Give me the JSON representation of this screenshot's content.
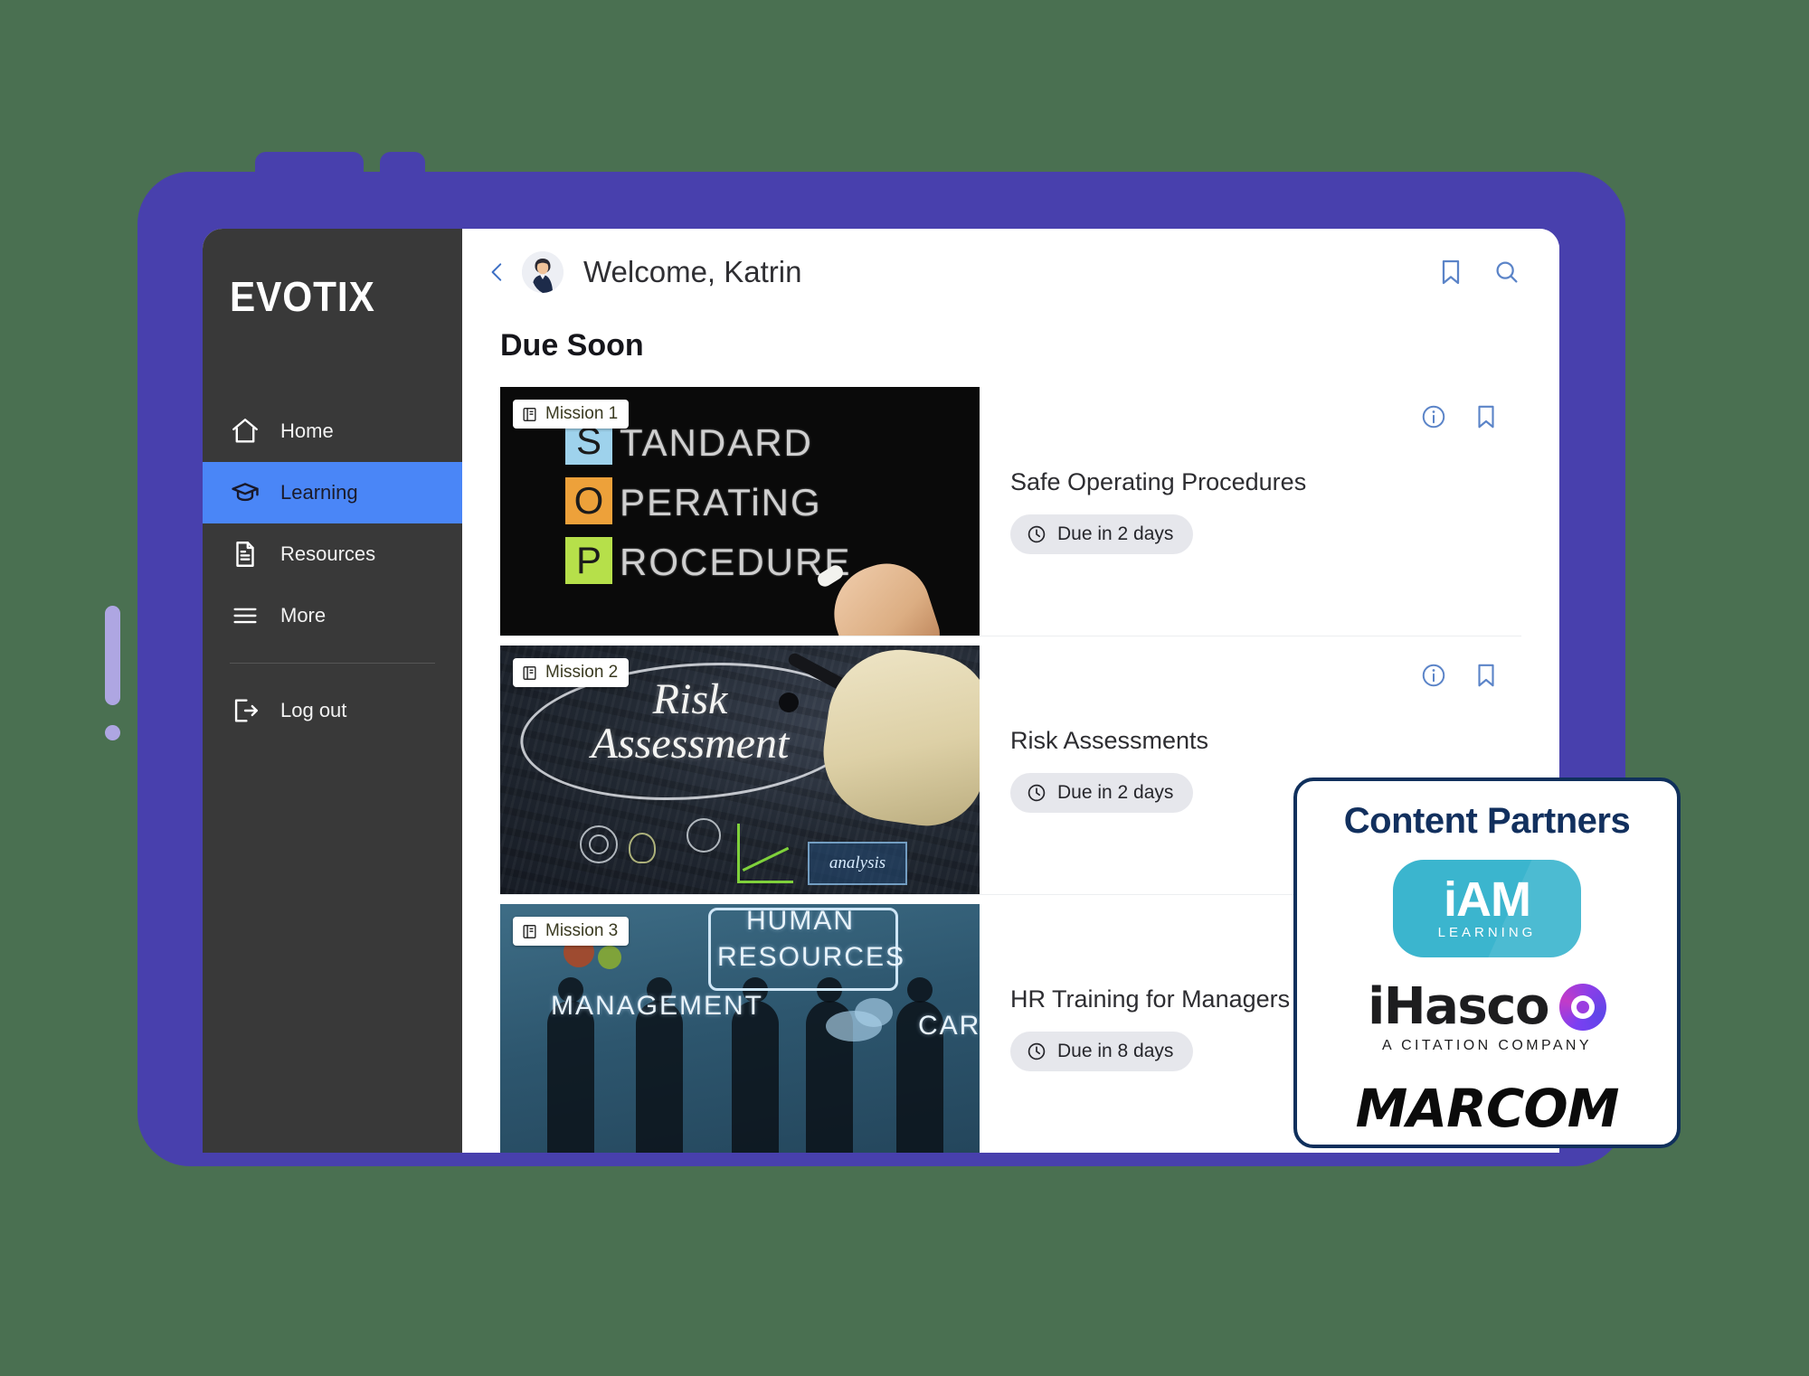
{
  "theme": {
    "page_background": "#4a7051",
    "device_bezel": "#4840ad",
    "sidebar_background": "#393939",
    "sidebar_active": "#4a86f7",
    "accent_blue": "#4a86f7",
    "icon_blue": "#5b84c8",
    "partners_navy": "#12305e",
    "iam_teal": "#3bb5ce",
    "ihasco_purple": "#9b3ee0"
  },
  "sidebar": {
    "brand": "EVOTIX",
    "items": [
      {
        "label": "Home",
        "icon": "home-icon",
        "active": false
      },
      {
        "label": "Learning",
        "icon": "graduation-cap-icon",
        "active": true
      },
      {
        "label": "Resources",
        "icon": "document-icon",
        "active": false
      },
      {
        "label": "More",
        "icon": "hamburger-icon",
        "active": false
      },
      {
        "label": "Log out",
        "icon": "logout-icon",
        "active": false
      }
    ]
  },
  "topbar": {
    "back_icon": "chevron-left-icon",
    "avatar": "user-avatar",
    "welcome": "Welcome, Katrin",
    "bookmark_icon": "bookmark-icon",
    "search_icon": "search-icon"
  },
  "main": {
    "section_title": "Due Soon",
    "cards": [
      {
        "badge": "Mission 1",
        "title": "Safe Operating Procedures",
        "due": "Due in 2 days",
        "thumb": "standard-operating-procedure-chalkboard",
        "thumb_text": {
          "l1": "S",
          "w1": "TANDARD",
          "l2": "O",
          "w2": "PERATiNG",
          "l3": "P",
          "w3": "ROCEDURE"
        }
      },
      {
        "badge": "Mission 2",
        "title": "Risk Assessments",
        "due": "Due in 2 days",
        "thumb": "risk-assessment-whiteboard",
        "thumb_text": {
          "line1": "Risk",
          "line2": "Assessment",
          "label": "analysis"
        }
      },
      {
        "badge": "Mission 3",
        "title": "HR Training for Managers (iA",
        "due": "Due in 8 days",
        "thumb": "human-resources-mindmap",
        "thumb_text": {
          "w1": "HUMAN",
          "w2": "RESOURCES",
          "w3": "MANAGEMENT",
          "w4": "CAREER"
        }
      }
    ]
  },
  "partners": {
    "title": "Content Partners",
    "logos": [
      {
        "name": "iam-learning-logo",
        "word": "iAM",
        "sub": "LEARNING"
      },
      {
        "name": "ihasco-logo",
        "word": "iHasco",
        "sub": "A CITATION COMPANY"
      },
      {
        "name": "marcom-logo",
        "word": "MARCOM"
      }
    ]
  }
}
